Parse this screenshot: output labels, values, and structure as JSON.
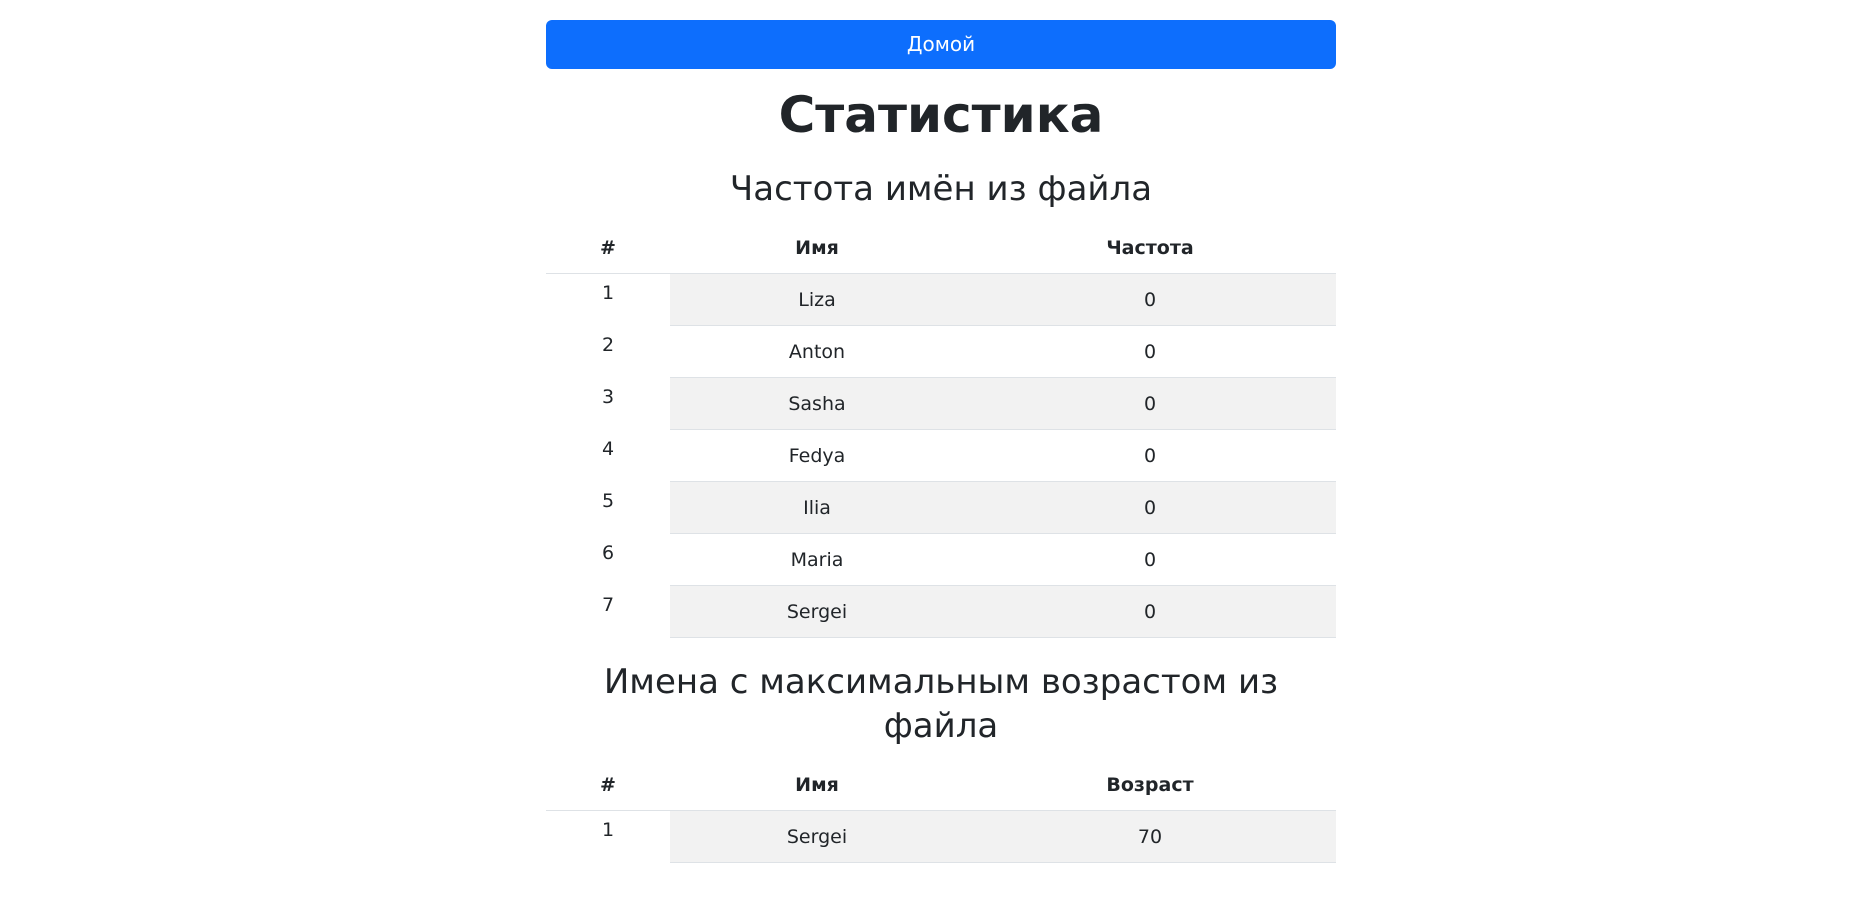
{
  "nav": {
    "home_label": "Домой"
  },
  "page": {
    "title": "Статистика"
  },
  "frequency": {
    "title": "Частота имён из файла",
    "headers": [
      "#",
      "Имя",
      "Частота"
    ],
    "rows": [
      {
        "idx": "1",
        "name": "Liza",
        "value": "0"
      },
      {
        "idx": "2",
        "name": "Anton",
        "value": "0"
      },
      {
        "idx": "3",
        "name": "Sasha",
        "value": "0"
      },
      {
        "idx": "4",
        "name": "Fedya",
        "value": "0"
      },
      {
        "idx": "5",
        "name": "Ilia",
        "value": "0"
      },
      {
        "idx": "6",
        "name": "Maria",
        "value": "0"
      },
      {
        "idx": "7",
        "name": "Sergei",
        "value": "0"
      }
    ]
  },
  "max_age": {
    "title": "Имена с максимальным возрастом из файла",
    "headers": [
      "#",
      "Имя",
      "Возраст"
    ],
    "rows": [
      {
        "idx": "1",
        "name": "Sergei",
        "value": "70"
      }
    ]
  },
  "colors": {
    "accent": "#0d6efd",
    "stripe": "#f2f2f2",
    "text": "#212529"
  }
}
